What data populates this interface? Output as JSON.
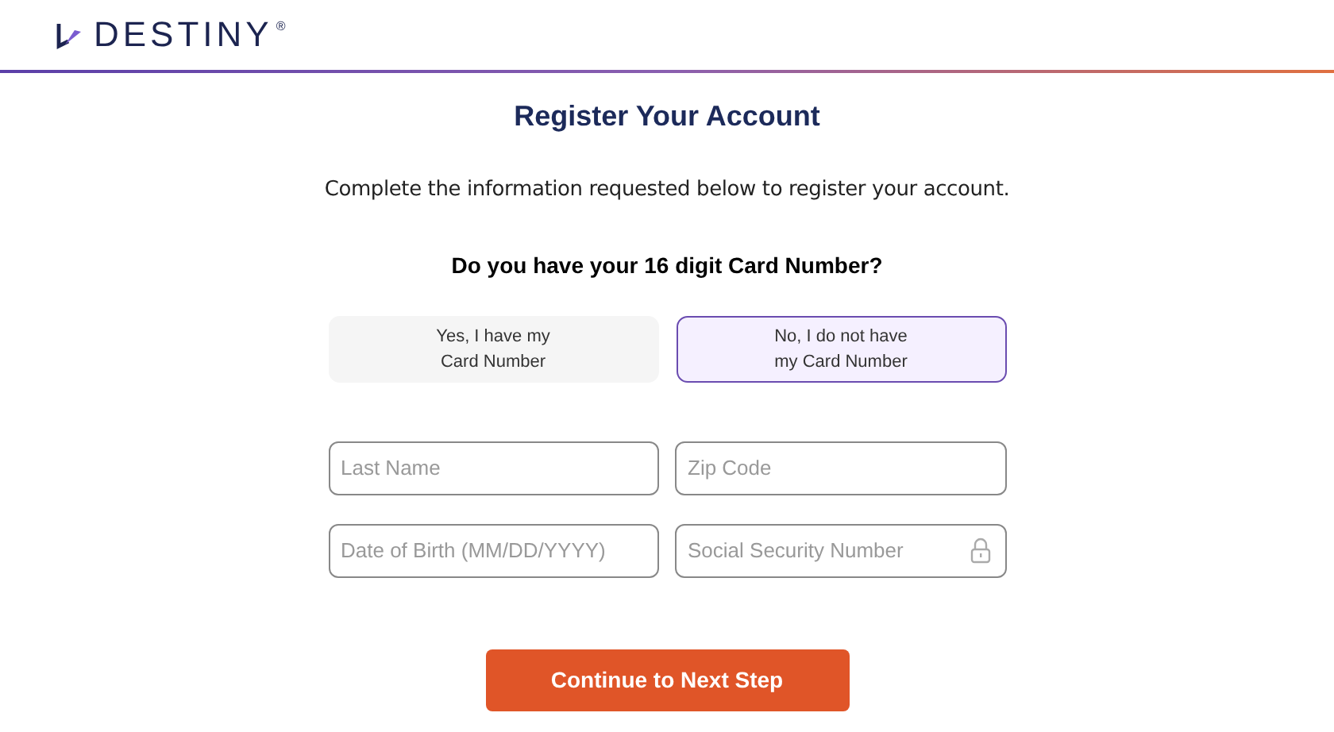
{
  "header": {
    "logo": "DESTINY",
    "logo_mark": "®"
  },
  "title": "Register Your Account",
  "intro": "Complete the information requested below to register your account.",
  "question": "Do you have your 16 digit Card Number?",
  "options": [
    {
      "label": "Yes, I have my Card Number",
      "selected": false
    },
    {
      "label": "No, I do not have my Card Number",
      "selected": true
    }
  ],
  "fields": [
    {
      "placeholder": "Last Name",
      "kind": "text"
    },
    {
      "placeholder": "Zip Code",
      "kind": "text"
    },
    {
      "placeholder": "Date of Birth (MM/DD/YYYY)",
      "kind": "text"
    },
    {
      "placeholder": "Social Security Number",
      "kind": "secure"
    }
  ],
  "submit": "Continue to Next Step"
}
